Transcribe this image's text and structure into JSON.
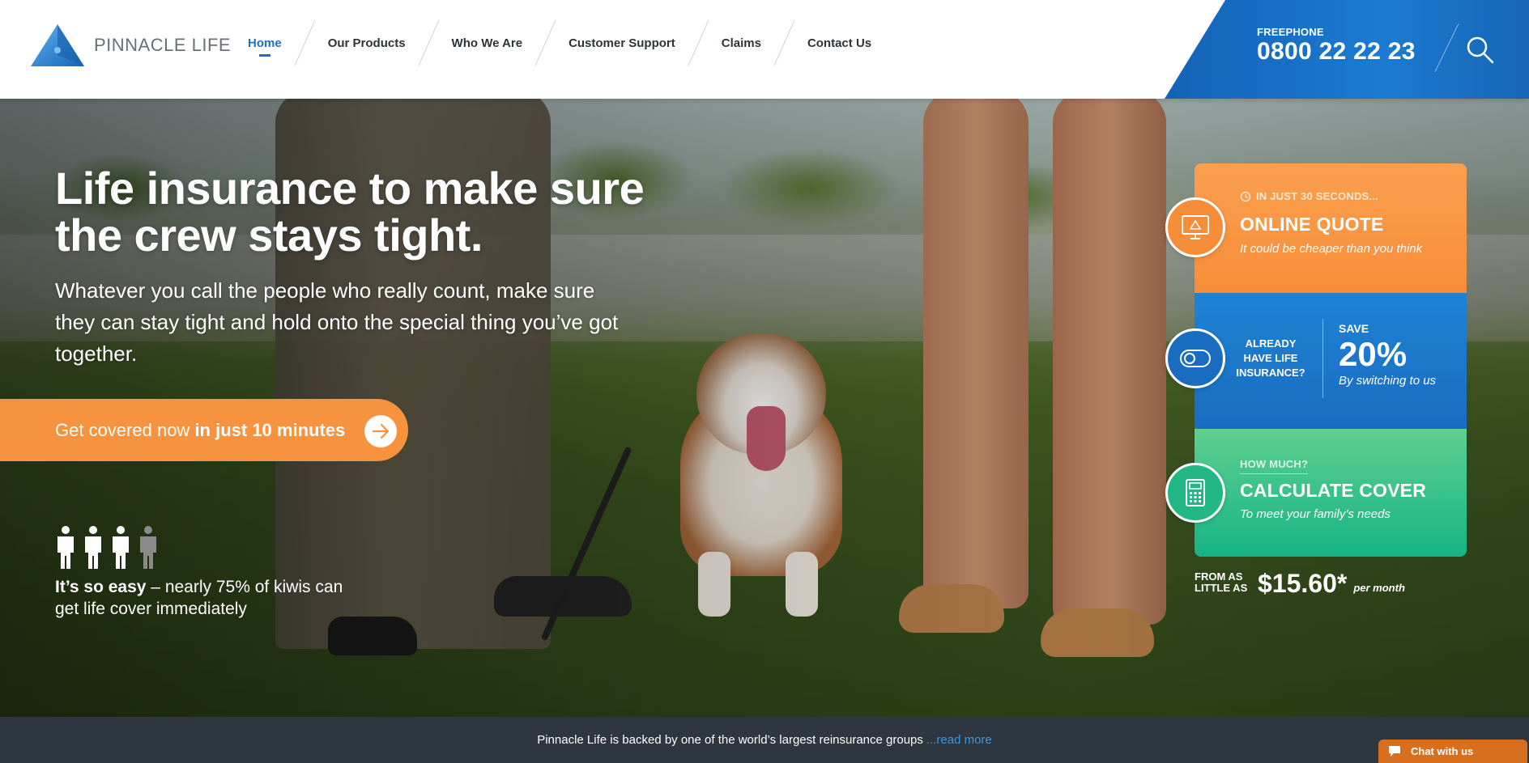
{
  "header": {
    "logo_text": "PINNACLE LIFE",
    "nav": [
      {
        "label": "Home",
        "active": true
      },
      {
        "label": "Our Products",
        "active": false
      },
      {
        "label": "Who We Are",
        "active": false
      },
      {
        "label": "Customer Support",
        "active": false
      },
      {
        "label": "Claims",
        "active": false
      },
      {
        "label": "Contact Us",
        "active": false
      }
    ],
    "freephone_label": "FREEPHONE",
    "freephone_number": "0800 22 22 23",
    "search_icon": "search-icon"
  },
  "hero": {
    "title": "Life insurance to make sure the crew stays tight.",
    "subtitle": "Whatever you call the people who really count, make sure they can stay tight and hold onto the special thing you’ve got together.",
    "cta_prefix": "Get covered now",
    "cta_bold": "in just 10 minutes",
    "cta_icon": "arrow-right-icon",
    "people_icon": "person-icon",
    "people_highlighted": 3,
    "people_total": 4,
    "easy_bold": "It’s so easy",
    "easy_rest": " – nearly 75% of kiwis can get life cover immediately"
  },
  "cards": {
    "quote": {
      "icon": "monitor-icon",
      "kicker_icon": "clock-icon",
      "kicker": "IN JUST 30 SECONDS...",
      "title": "ONLINE QUOTE",
      "subtitle": "It could be cheaper than you think"
    },
    "save": {
      "icon": "toggle-icon",
      "question": "ALREADY HAVE LIFE INSURANCE?",
      "label": "SAVE",
      "value": "20%",
      "subtitle": "By switching to us"
    },
    "calc": {
      "icon": "calculator-icon",
      "kicker": "HOW MUCH?",
      "title": "CALCULATE COVER",
      "subtitle": "To meet your family’s needs"
    }
  },
  "price": {
    "from_label": "FROM AS LITTLE AS",
    "value": "$15.60*",
    "per": "per month"
  },
  "footer": {
    "text": "Pinnacle Life is backed by one of the world’s largest reinsurance groups",
    "link": "...read more"
  },
  "chat": {
    "icon": "chat-bubble-icon",
    "label": "Chat with us"
  },
  "colors": {
    "brand_blue": "#1a6cc1",
    "accent_orange": "#f7923f",
    "green": "#15b485",
    "footer_bg": "#2e3640"
  }
}
